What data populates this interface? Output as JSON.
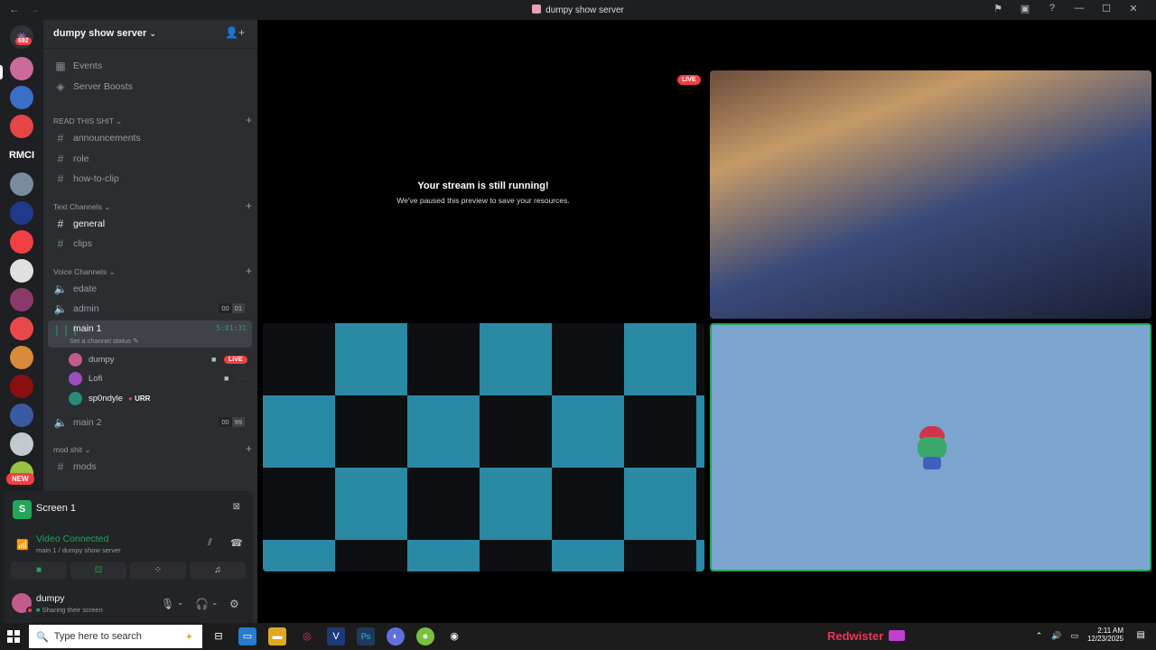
{
  "window": {
    "title": "dumpy show server",
    "controls": [
      "⚑",
      "▣",
      "?",
      "—",
      "☐",
      "✕"
    ]
  },
  "guild_bar": {
    "dm_badge": "692",
    "rmci_label": "RMCI",
    "new_badge": "NEW"
  },
  "server": {
    "name": "dumpy show server",
    "top_items": [
      {
        "label": "Events",
        "icon": "calendar-icon"
      },
      {
        "label": "Server Boosts",
        "icon": "boost-icon"
      }
    ],
    "categories": {
      "read": "READ THIS SHIT",
      "text": "Text Channels",
      "voice": "Voice Channels",
      "mod": "mod shit"
    },
    "read_channels": [
      "announcements",
      "role",
      "how-to-clip"
    ],
    "text_channels": [
      "general",
      "clips"
    ],
    "voice_channels": {
      "edate": "edate",
      "admin": "admin",
      "admin_count": [
        "00",
        "01"
      ],
      "main1": "main 1",
      "main1_timer": "5:01:31",
      "main1_status": "Set a channel status",
      "main2": "main 2",
      "main2_count": [
        "00",
        "99"
      ]
    },
    "voice_users": [
      {
        "name": "dumpy",
        "live": "LIVE"
      },
      {
        "name": "Lofi"
      },
      {
        "name": "sp0ndyle",
        "tag": "URR"
      }
    ],
    "mod_channels": [
      "mods"
    ]
  },
  "screen_panel": {
    "label": "Screen 1"
  },
  "voice_panel": {
    "status": "Video Connected",
    "location": "main 1 / dumpy show server"
  },
  "user_panel": {
    "name": "dumpy",
    "status": "Sharing their screen"
  },
  "stage": {
    "paused_title": "Your stream is still running!",
    "paused_subtitle": "We've paused this preview to save your resources.",
    "live_label": "LIVE"
  },
  "taskbar": {
    "search_placeholder": "Type here to search",
    "brand_text": "Redwister",
    "time": "2:11 AM",
    "date": "12/23/2025"
  },
  "colors": {
    "accent_green": "#23a55a",
    "live_red": "#f23f43",
    "sidebar_bg": "#2b2d31",
    "panel_bg": "#232428"
  }
}
